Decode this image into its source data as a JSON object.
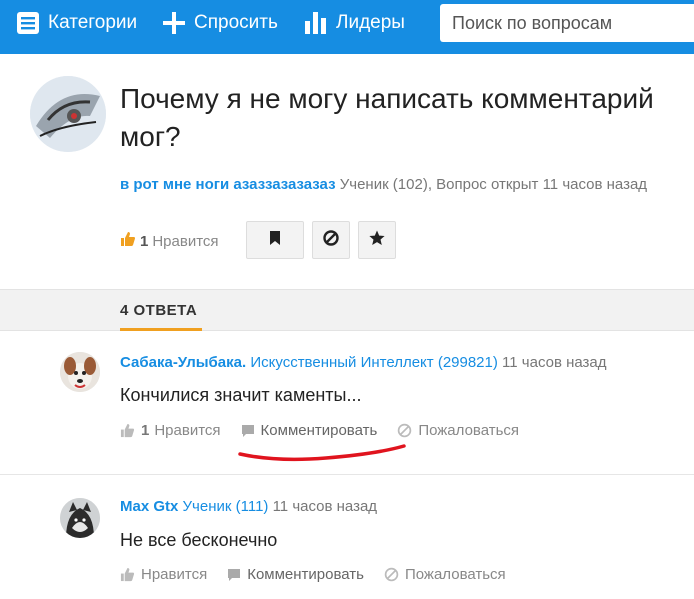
{
  "nav": {
    "categories_label": "Категории",
    "ask_label": "Спросить",
    "leaders_label": "Лидеры",
    "search_placeholder": "Поиск по вопросам"
  },
  "question": {
    "title": "Почему я не могу написать комментарий мог?",
    "author": "в рот мне ноги азаззазазазаз",
    "meta": "Ученик (102), Вопрос открыт 11 часов назад",
    "likes_count": "1",
    "likes_label": "Нравится"
  },
  "answers_header": "4 ОТВЕТА",
  "answers": [
    {
      "author": "Сабака-Улыбака.",
      "rank": "Искусственный Интеллект (299821)",
      "time": "11 часов назад",
      "text": "Кончилися значит каменты...",
      "likes_count": "1",
      "like_label": "Нравится",
      "comment_label": "Комментировать",
      "report_label": "Пожаловаться"
    },
    {
      "author": "Max Gtx",
      "rank": "Ученик (111)",
      "time": "11 часов назад",
      "text": "Не все бесконечно",
      "like_label": "Нравится",
      "comment_label": "Комментировать",
      "report_label": "Пожаловаться"
    }
  ],
  "colors": {
    "brand": "#168de2",
    "accent": "#f0a020",
    "annotation": "#e0141e"
  }
}
